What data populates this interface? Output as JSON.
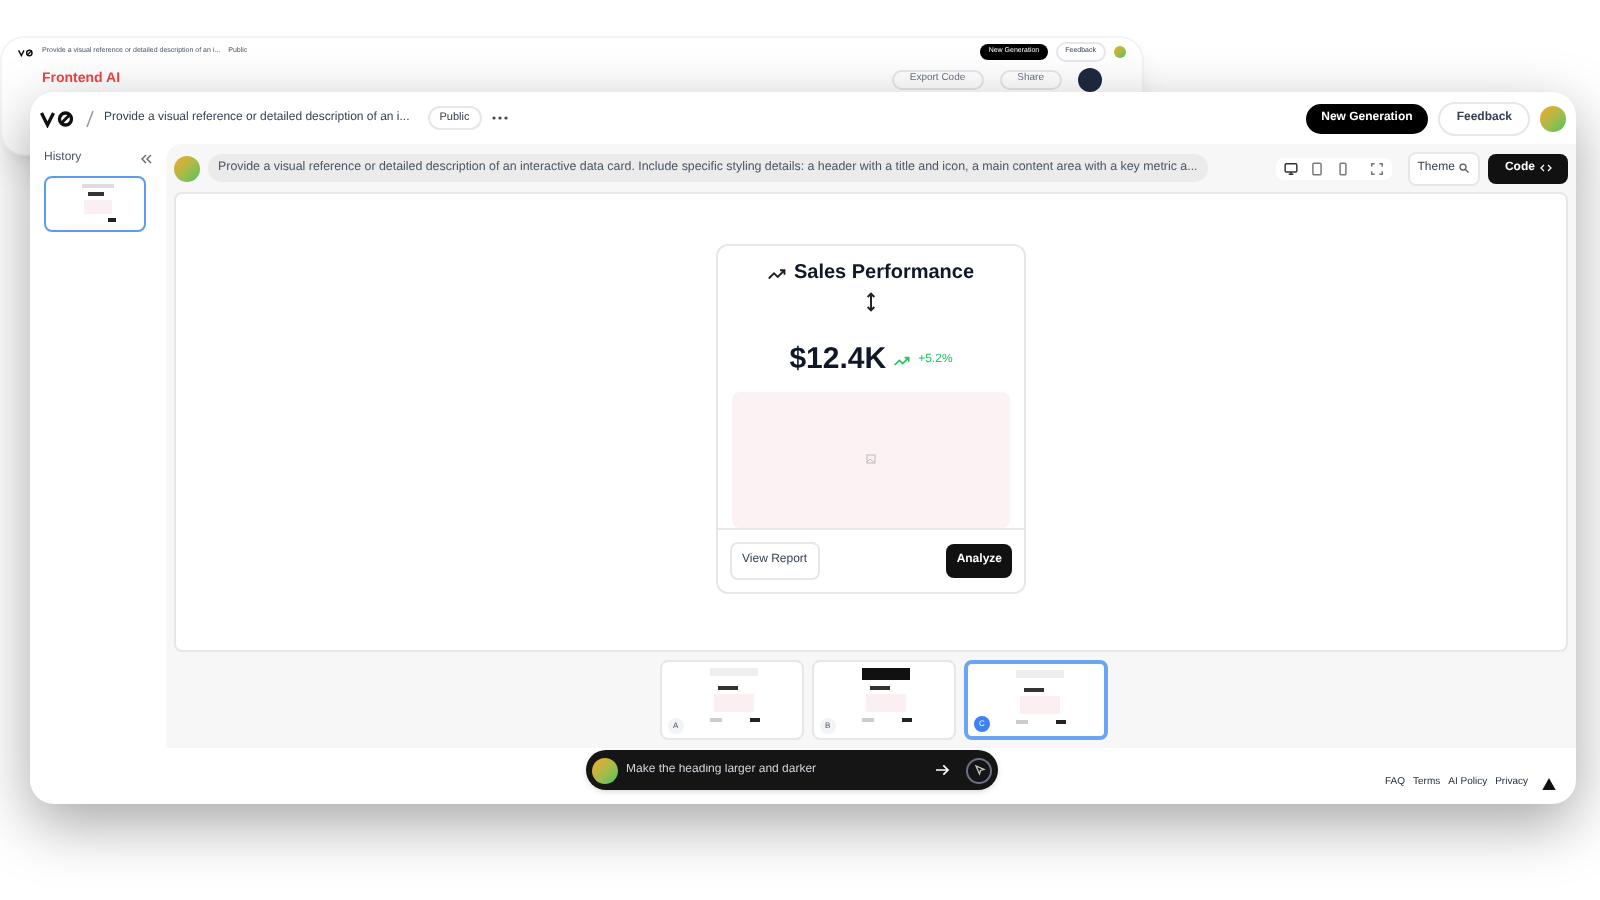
{
  "background_window": {
    "title": "Provide a visual reference or detailed description of an i...",
    "visibility": "Public",
    "buttons": [
      {
        "label": "New Generation",
        "kind": "primary"
      },
      {
        "label": "Feedback",
        "kind": "outline"
      }
    ],
    "app_name": "Frontend AI",
    "actions": [
      "Export Code",
      "Share"
    ]
  },
  "window": {
    "title": "Provide a visual reference or detailed description of an i...",
    "visibility": "Public"
  },
  "header_buttons": [
    {
      "label": "New Generation",
      "kind": "primary"
    },
    {
      "label": "Feedback",
      "kind": "outline"
    }
  ],
  "sidebar": {
    "title": "History",
    "items": [
      {
        "selected": true
      }
    ]
  },
  "prompt": "Provide a visual reference or detailed description of an interactive data card. Include specific styling details: a header with a title and icon, a main content area with a key metric a...",
  "toolbar": {
    "theme": "Theme",
    "code": "Code"
  },
  "card": {
    "title": "Sales Performance",
    "value": "$12.4K",
    "change": "+5.2%",
    "actions": [
      {
        "label": "View Report",
        "kind": "outline"
      },
      {
        "label": "Analyze",
        "kind": "primary"
      }
    ]
  },
  "variants": [
    {
      "label": "A",
      "selected": false,
      "kind": "light"
    },
    {
      "label": "B",
      "selected": false,
      "kind": "dark-header"
    },
    {
      "label": "C",
      "selected": true,
      "kind": "light"
    }
  ],
  "chat_input": {
    "placeholder": "Make the heading larger and darker"
  },
  "footer_links": [
    "FAQ",
    "Terms",
    "AI Policy",
    "Privacy"
  ]
}
